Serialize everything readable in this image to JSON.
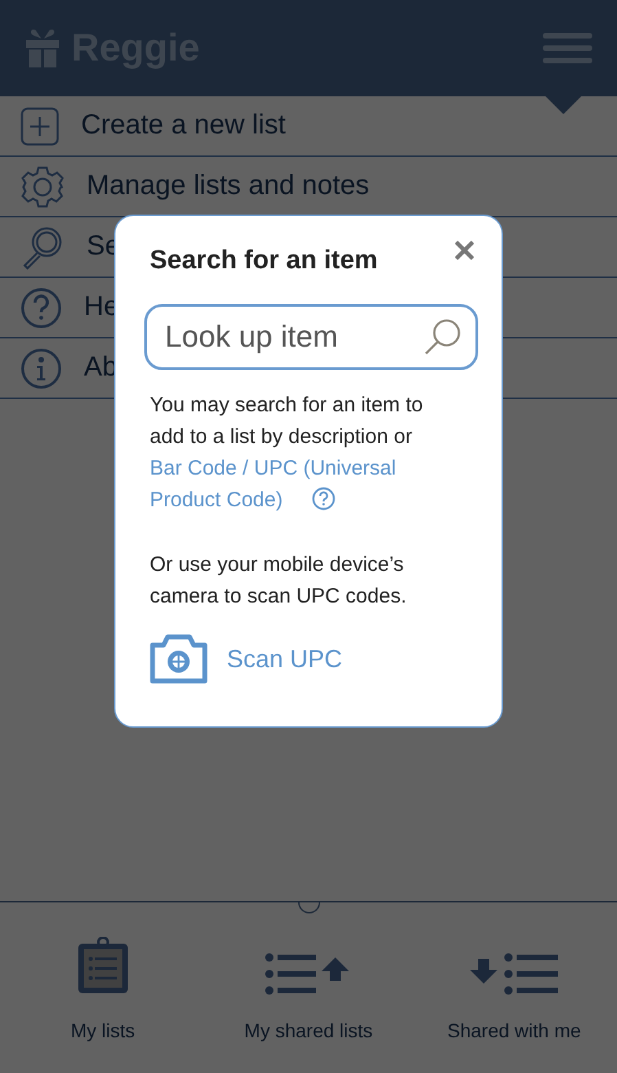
{
  "header": {
    "title": "Reggie"
  },
  "menu": [
    {
      "kind": "create",
      "label": "Create a new list"
    },
    {
      "kind": "manage",
      "label": "Manage lists and notes"
    },
    {
      "kind": "search",
      "label": "Se"
    },
    {
      "kind": "help",
      "label": "He"
    },
    {
      "kind": "about",
      "label": "Ab"
    }
  ],
  "dialog": {
    "title": "Search for an item",
    "search": {
      "placeholder": "Look up item"
    },
    "intro": "You may search for an item to add to a list by description or",
    "link": "Bar Code / UPC (Universal Product Code)",
    "camera_text": "Or use your mobile device’s camera to scan UPC codes.",
    "scan_label": "Scan UPC"
  },
  "bottom_nav": [
    {
      "kind": "clipboard",
      "label": "My lists"
    },
    {
      "kind": "share-out",
      "label": "My shared lists"
    },
    {
      "kind": "share-in",
      "label": "Shared with me"
    }
  ]
}
